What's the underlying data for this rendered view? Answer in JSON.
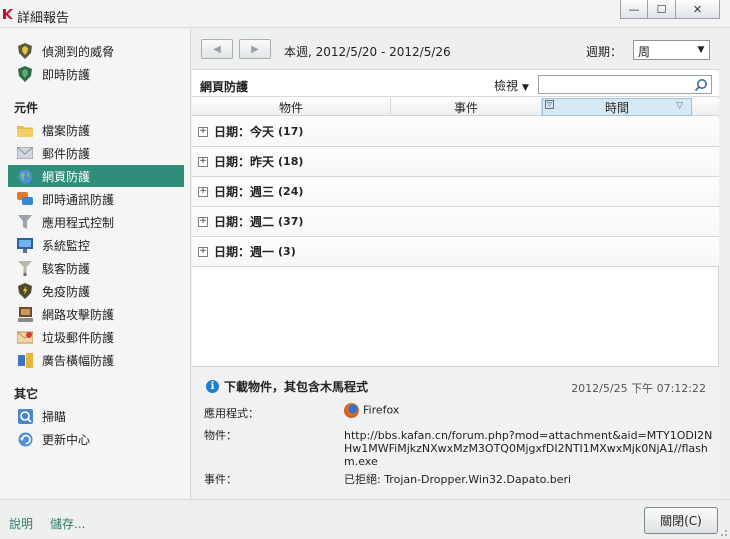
{
  "window": {
    "title": "詳細報告",
    "minimize": "—",
    "maximize": "☐",
    "close": "✕"
  },
  "sidebar": {
    "top_items": [
      {
        "label": "偵測到的威脅",
        "icon": "shield-threat-icon"
      },
      {
        "label": "即時防護",
        "icon": "shield-icon"
      }
    ],
    "components_heading": "元件",
    "components": [
      {
        "label": "檔案防護",
        "icon": "folder-icon"
      },
      {
        "label": "郵件防護",
        "icon": "mail-icon"
      },
      {
        "label": "網頁防護",
        "icon": "globe-icon",
        "active": true
      },
      {
        "label": "即時通訊防護",
        "icon": "chat-icon"
      },
      {
        "label": "應用程式控制",
        "icon": "filter-icon"
      },
      {
        "label": "系統監控",
        "icon": "monitor-icon"
      },
      {
        "label": "駭客防護",
        "icon": "funnel-icon"
      },
      {
        "label": "免疫防護",
        "icon": "immune-shield-icon"
      },
      {
        "label": "網路攻擊防護",
        "icon": "network-attack-icon"
      },
      {
        "label": "垃圾郵件防護",
        "icon": "spam-icon"
      },
      {
        "label": "廣告橫幅防護",
        "icon": "banner-icon"
      }
    ],
    "other_heading": "其它",
    "other": [
      {
        "label": "掃瞄",
        "icon": "scan-icon"
      },
      {
        "label": "更新中心",
        "icon": "update-icon"
      }
    ]
  },
  "toolbar": {
    "back": "◀",
    "forward": "▶",
    "range": "本週, 2012/5/20 - 2012/5/26",
    "period_label": "週期：",
    "period_value": "周",
    "period_arrow": "▼"
  },
  "section": {
    "title": "網頁防護",
    "view_menu": "檢視",
    "view_arrow": "▼",
    "search_placeholder": ""
  },
  "columns": {
    "object": "物件",
    "event": "事件",
    "time": "時間",
    "filter": "▽",
    "sort": "▽"
  },
  "groups": [
    {
      "label": "日期：今天",
      "count": "(17)"
    },
    {
      "label": "日期：昨天",
      "count": "(18)"
    },
    {
      "label": "日期：週三",
      "count": "(24)"
    },
    {
      "label": "日期：週二",
      "count": "(37)"
    },
    {
      "label": "日期：週一",
      "count": "(3)"
    }
  ],
  "details": {
    "title": "下載物件，其包含木馬程式",
    "datetime": "2012/5/25 下午 07:12:22",
    "app_label": "應用程式：",
    "app_value": "Firefox",
    "object_label": "物件：",
    "object_value": "http://bbs.kafan.cn/forum.php?mod=attachment&aid=MTY1ODI2NHw1MWFiMjkzNXwxMzM3OTQ0MjgxfDI2NTI1MXwxMjk0NjA1//flashm.exe",
    "event_label": "事件：",
    "event_value": "已拒絕: Trojan-Dropper.Win32.Dapato.beri"
  },
  "footer": {
    "help": "說明",
    "save": "儲存...",
    "close": "關閉(C)"
  }
}
